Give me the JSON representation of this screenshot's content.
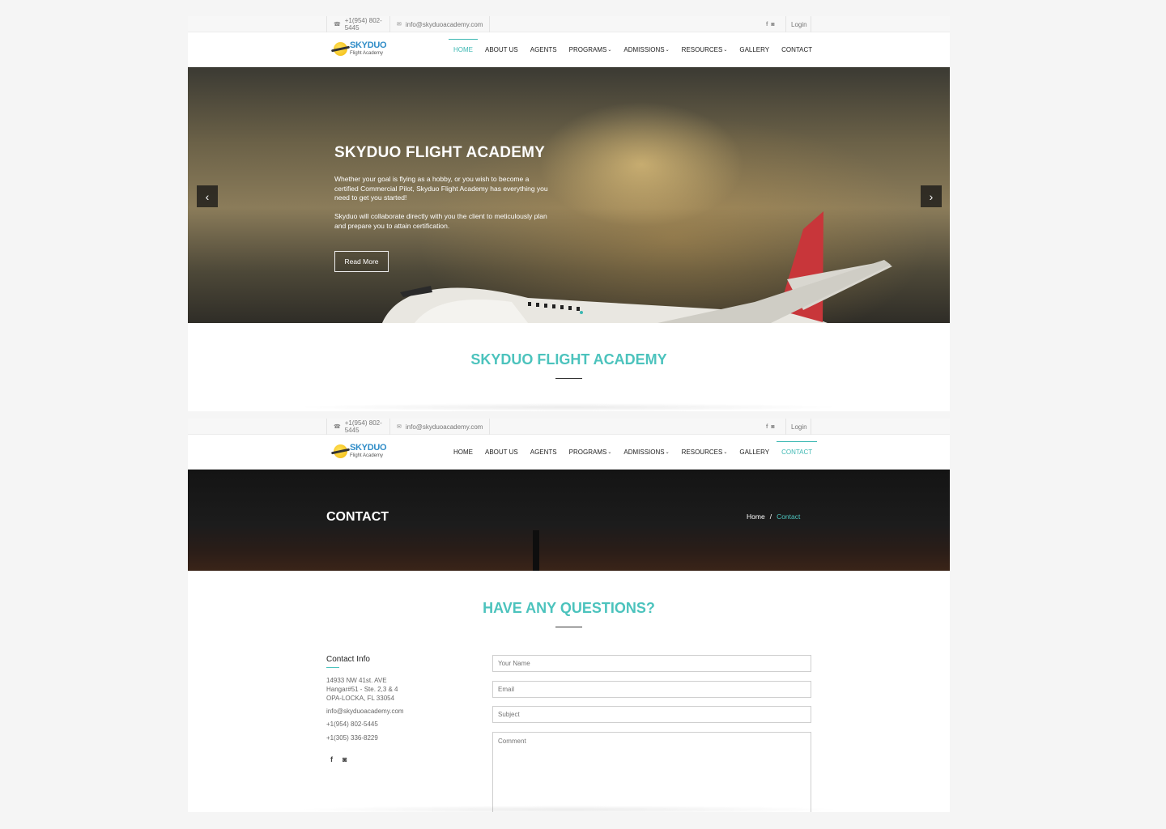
{
  "topbar": {
    "phone_icon": "phone-icon",
    "phone": "+1(954) 802-5445",
    "mail_icon": "envelope-icon",
    "email": "info@skyduoacademy.com",
    "facebook_icon": "facebook-icon",
    "instagram_icon": "instagram-icon",
    "login": "Login"
  },
  "brand": {
    "name": "SKYDUO",
    "tagline": "Flight Academy",
    "color": "#2f8cc7"
  },
  "nav": {
    "home": "HOME",
    "about": "ABOUT US",
    "agents": "AGENTS",
    "programs": "PROGRAMS",
    "admissions": "ADMISSIONS",
    "resources": "RESOURCES",
    "gallery": "GALLERY",
    "contact": "CONTACT"
  },
  "hero": {
    "title": "SKYDUO FLIGHT ACADEMY",
    "p1": "Whether your goal is flying as a hobby, or you wish to become a certified Commercial Pilot, Skyduo Flight Academy has everything you need to get you started!",
    "p2": "Skyduo will collaborate directly with you the client to meticulously plan and prepare you to attain certification.",
    "button": "Read More",
    "prev": "‹",
    "next": "›"
  },
  "home_section": {
    "title": "SKYDUO FLIGHT ACADEMY"
  },
  "contact_page": {
    "title": "CONTACT",
    "crumb_home": "Home",
    "crumb_sep": "/",
    "crumb_current": "Contact",
    "section_title": "HAVE ANY QUESTIONS?",
    "info_title": "Contact Info",
    "address_1": "14933 NW 41st. AVE",
    "address_2": "Hangar#51 - Ste. 2,3 & 4",
    "address_3": "OPA-LOCKA, FL 33054",
    "email": "info@skyduoacademy.com",
    "phone_1": "+1(954) 802-5445",
    "phone_2": "+1(305) 336-8229",
    "form": {
      "name_placeholder": "Your Name",
      "email_placeholder": "Email",
      "subject_placeholder": "Subject",
      "comment_placeholder": "Comment"
    }
  },
  "colors": {
    "accent": "#4cc3bd",
    "active_nav": "#3db8b3"
  }
}
